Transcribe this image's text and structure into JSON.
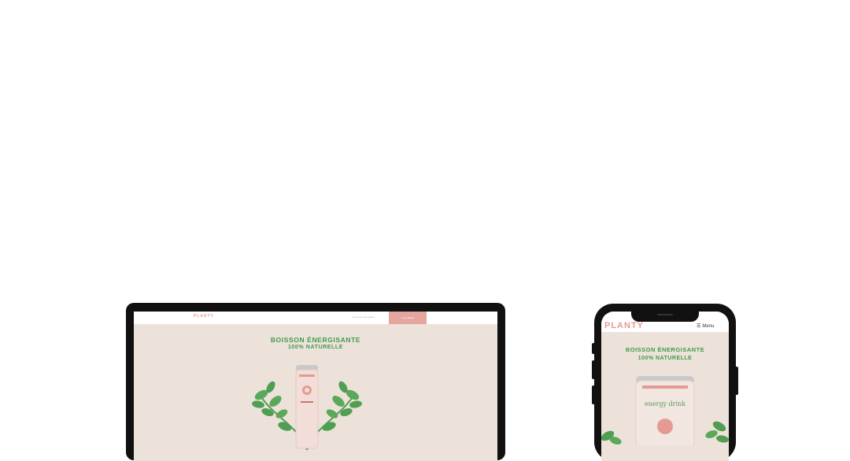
{
  "laptop": {
    "logo": "PLANTY",
    "nav_link": "Comment ça marche",
    "nav_button": "Commander",
    "headline_line1": "BOISSON ÉNERGISANTE",
    "headline_line2": "100% NATURELLE"
  },
  "phone": {
    "logo": "PLANTY",
    "menu_icon": "hamburger-icon",
    "menu_label": "Menu",
    "headline_line1": "BOISSON ÉNERGISANTE",
    "headline_line2": "100% NATURELLE",
    "can_text": "energy drink"
  },
  "colors": {
    "brand_pink": "#e59b93",
    "button_pink": "#e6a59d",
    "brand_green": "#3f9a4a",
    "screen_bg": "#ece2da",
    "device_frame": "#111111"
  }
}
